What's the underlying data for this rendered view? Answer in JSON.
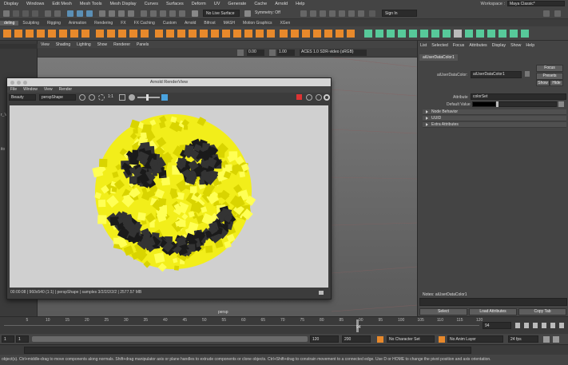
{
  "menubar": {
    "items": [
      "Display",
      "Windows",
      "Edit Mesh",
      "Mesh Tools",
      "Mesh Display",
      "Curves",
      "Surfaces",
      "Deform",
      "UV",
      "Generate",
      "Cache",
      "Arnold",
      "Help"
    ],
    "workspace_label": "Workspace :",
    "workspace_value": "Maya Classic*"
  },
  "statusline": {
    "no_live_surface": "No Live Surface",
    "symmetry": "Symmetry: Off",
    "sign_in": "Sign In"
  },
  "shelf_tabs": [
    "deling",
    "Sculpting",
    "Rigging",
    "Animation",
    "Rendering",
    "FX",
    "FX Caching",
    "Custom",
    "Arnold",
    "Bifrost",
    "MASH",
    "Motion Graphics",
    "XGen"
  ],
  "left_labels": [
    "r_V",
    "ito"
  ],
  "viewport": {
    "menu": [
      "View",
      "Shading",
      "Lighting",
      "Show",
      "Renderer",
      "Panels"
    ],
    "value_a": "0.00",
    "value_b": "1.00",
    "color_space": "ACES 1.0 SDR-video (sRGB)",
    "camera_label": "persp"
  },
  "render_view": {
    "title": "Arnold RenderView",
    "menu": [
      "File",
      "Window",
      "View",
      "Render"
    ],
    "aov": "Beauty",
    "camera": "perspShape",
    "zoom": "1:1",
    "status": "00:00:08 | 960x540 (1:1) | perspShape | samples 3/2/2/2/2/2 | 2577.57 MB"
  },
  "attribute_editor": {
    "menu": [
      "List",
      "Selected",
      "Focus",
      "Attributes",
      "Display",
      "Show",
      "Help"
    ],
    "tab": "aiUserDataColor1",
    "node_label": "aiUserDataColor:",
    "node_value": "aiUserDataColor1",
    "focus_btn": "Focus",
    "presets_btn": "Presets",
    "show_btn": "Show",
    "hide_btn": "Hide",
    "attribute_label": "Attribute",
    "attribute_value": "colorSet",
    "default_value_label": "Default Value",
    "sections": [
      "Node Behavior",
      "UUID",
      "Extra Attributes"
    ],
    "notes_label": "Notes: aiUserDataColor1",
    "select_btn": "Select",
    "load_btn": "Load Attributes",
    "copy_btn": "Copy Tab"
  },
  "timeline": {
    "ticks": [
      "5",
      "10",
      "15",
      "20",
      "25",
      "30",
      "35",
      "40",
      "45",
      "50",
      "55",
      "60",
      "65",
      "70",
      "75",
      "80",
      "85",
      "90",
      "95",
      "100",
      "105",
      "110",
      "115",
      "120"
    ],
    "current_frame_marker": "94",
    "current_frame": "94"
  },
  "range": {
    "start": "1",
    "anim_start": "1",
    "end": "120",
    "anim_end": "200",
    "character_set": "No Character Set",
    "anim_layer": "No Anim Layer",
    "fps": "24 fps"
  },
  "helpline": "object(s). Ctrl+middle-drag to move components along normals. Shift+drag manipulator axis or plane handles to extrude components or clone objects. Ctrl+Shift+drag to constrain movement to a connected edge. Use D or HOME to change the pivot position and axis orientation.",
  "colors": {
    "accent_orange": "#e8892b",
    "shelf_green": "#57c99a",
    "smiley_yellow": "#f2ee1a"
  }
}
